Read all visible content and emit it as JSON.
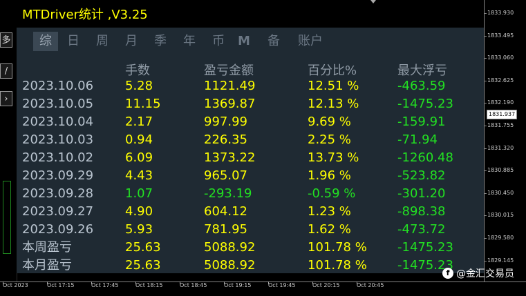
{
  "app": {
    "title": "MTDriver统计 ,V3.25"
  },
  "tabs": [
    {
      "label": "综",
      "active": true
    },
    {
      "label": "日",
      "active": false
    },
    {
      "label": "周",
      "active": false
    },
    {
      "label": "月",
      "active": false
    },
    {
      "label": "季",
      "active": false
    },
    {
      "label": "年",
      "active": false
    },
    {
      "label": "币",
      "active": false
    },
    {
      "label": "M",
      "active": false
    },
    {
      "label": "备",
      "active": false
    },
    {
      "label": "账户",
      "active": false
    }
  ],
  "table": {
    "headers": [
      "手数",
      "盈亏金额",
      "百分比%",
      "最大浮亏"
    ],
    "rows": [
      {
        "date": "2023.10.06",
        "lots": "5.28",
        "pl": "1121.49",
        "pct": "12.51 %",
        "dd": "-463.59",
        "neg": false
      },
      {
        "date": "2023.10.05",
        "lots": "11.15",
        "pl": "1369.87",
        "pct": "12.13 %",
        "dd": "-1475.23",
        "neg": false
      },
      {
        "date": "2023.10.04",
        "lots": "2.17",
        "pl": "997.99",
        "pct": "9.69 %",
        "dd": "-159.91",
        "neg": false
      },
      {
        "date": "2023.10.03",
        "lots": "0.94",
        "pl": "226.35",
        "pct": "2.25 %",
        "dd": "-71.94",
        "neg": false
      },
      {
        "date": "2023.10.02",
        "lots": "6.09",
        "pl": "1373.22",
        "pct": "13.73 %",
        "dd": "-1260.48",
        "neg": false
      },
      {
        "date": "2023.09.29",
        "lots": "4.43",
        "pl": "965.07",
        "pct": "1.96 %",
        "dd": "-523.82",
        "neg": false
      },
      {
        "date": "2023.09.28",
        "lots": "1.07",
        "pl": "-293.19",
        "pct": "-0.59 %",
        "dd": "-301.20",
        "neg": true
      },
      {
        "date": "2023.09.27",
        "lots": "4.90",
        "pl": "604.12",
        "pct": "1.23 %",
        "dd": "-898.38",
        "neg": false
      },
      {
        "date": "2023.09.26",
        "lots": "5.93",
        "pl": "781.95",
        "pct": "1.62 %",
        "dd": "-473.72",
        "neg": false
      },
      {
        "date": "本周盈亏",
        "lots": "25.63",
        "pl": "5088.92",
        "pct": "101.78 %",
        "dd": "-1475.23",
        "neg": false
      },
      {
        "date": "本月盈亏",
        "lots": "25.63",
        "pl": "5088.92",
        "pct": "101.78 %",
        "dd": "-1475.23",
        "neg": false
      }
    ]
  },
  "price_axis": {
    "ticks": [
      "1833.930",
      "1833.495",
      "1833.060",
      "1832.625",
      "1832.190",
      "1831.755",
      "1831.320",
      "1830.885",
      "1830.450",
      "1830.015",
      "1829.580",
      "1829.145"
    ],
    "current": "1831.937"
  },
  "time_axis": {
    "labels": [
      "Oct 2023",
      "Oct 17:15",
      "Oct 17:45",
      "Oct 18:15",
      "Oct 18:45",
      "Oct 19:15",
      "Oct 19:45",
      "Oct 20:15",
      "Oct 20:45"
    ]
  },
  "left_toolbar": {
    "items": [
      "多",
      "/",
      "›"
    ]
  },
  "watermark": {
    "text": "@金汇交易员",
    "icon": "f"
  },
  "colors": {
    "positive": "#ffff00",
    "negative": "#22e022",
    "panel_bg": "#1f2a33"
  }
}
